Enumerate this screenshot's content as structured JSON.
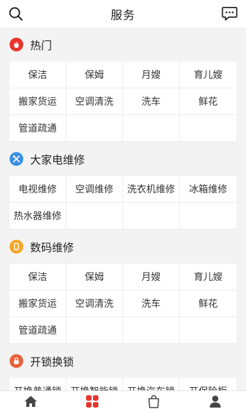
{
  "header": {
    "title": "服务",
    "search_icon": "search-icon",
    "message_icon": "message-icon"
  },
  "sections": [
    {
      "title": "热门",
      "icon": "fire-icon",
      "icon_color": "#e8342c",
      "items": [
        "保洁",
        "保姆",
        "月嫂",
        "育儿嫂",
        "搬家货运",
        "空调清洗",
        "洗车",
        "鲜花",
        "管道疏通"
      ]
    },
    {
      "title": "大家电维修",
      "icon": "tools-icon",
      "icon_color": "#3a8ee6",
      "items": [
        "电视维修",
        "空调维修",
        "洗衣机维修",
        "冰箱维修",
        "热水器维修"
      ]
    },
    {
      "title": "数码维修",
      "icon": "phone-icon",
      "icon_color": "#f5a623",
      "items": [
        "保洁",
        "保姆",
        "月嫂",
        "育儿嫂",
        "搬家货运",
        "空调清洗",
        "洗车",
        "鲜花",
        "管道疏通"
      ]
    },
    {
      "title": "开锁换锁",
      "icon": "lock-icon",
      "icon_color": "#e8623c",
      "items": [
        "开换普通锁",
        "开换智能锁",
        "开换汽车锁",
        "开保险柜"
      ]
    }
  ],
  "tabbar": {
    "items": [
      {
        "icon": "home-icon",
        "active": false
      },
      {
        "icon": "services-grid-icon",
        "active": true
      },
      {
        "icon": "shop-bag-icon",
        "active": false
      },
      {
        "icon": "user-icon",
        "active": false
      }
    ],
    "active_color": "#e8342c",
    "inactive_color": "#444444"
  }
}
